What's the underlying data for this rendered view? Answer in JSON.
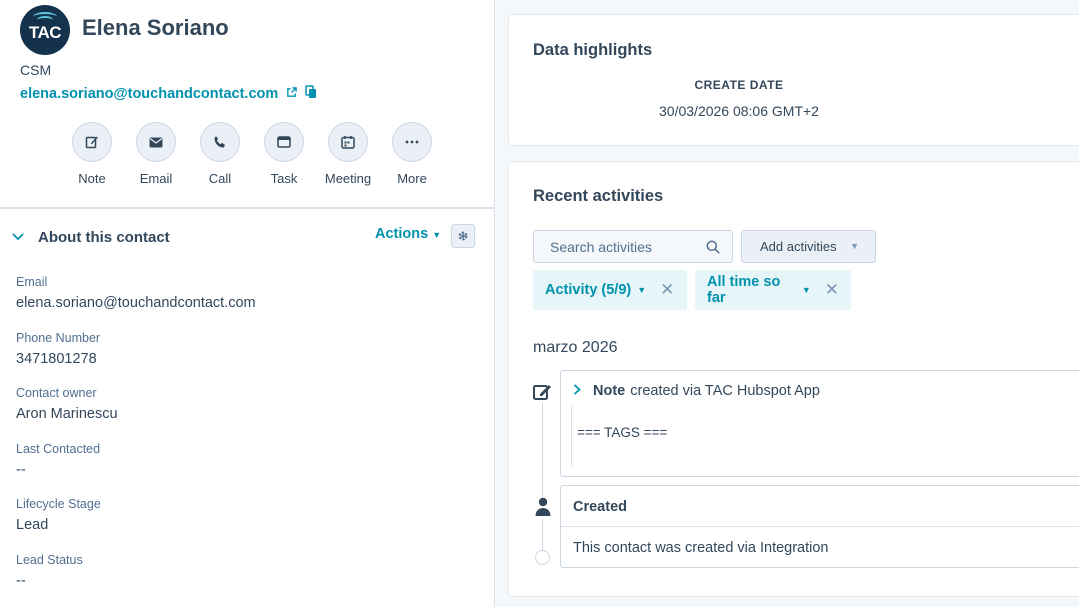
{
  "contact": {
    "avatar_text": "TAC",
    "name": "Elena Soriano",
    "job_title": "CSM",
    "email": "elena.soriano@touchandcontact.com"
  },
  "quick_actions": [
    {
      "label": "Note",
      "icon": "note-edit-icon"
    },
    {
      "label": "Email",
      "icon": "envelope-icon"
    },
    {
      "label": "Call",
      "icon": "phone-icon"
    },
    {
      "label": "Task",
      "icon": "task-icon"
    },
    {
      "label": "Meeting",
      "icon": "calendar-icon"
    },
    {
      "label": "More",
      "icon": "more-dots-icon"
    }
  ],
  "about": {
    "title": "About this contact",
    "actions_label": "Actions",
    "properties": [
      {
        "label": "Email",
        "value": "elena.soriano@touchandcontact.com"
      },
      {
        "label": "Phone Number",
        "value": "3471801278"
      },
      {
        "label": "Contact owner",
        "value": "Aron Marinescu"
      },
      {
        "label": "Last Contacted",
        "value": "--"
      },
      {
        "label": "Lifecycle Stage",
        "value": "Lead"
      },
      {
        "label": "Lead Status",
        "value": "--"
      }
    ]
  },
  "highlights": {
    "title": "Data highlights",
    "create_date_label": "CREATE DATE",
    "create_date_value": "30/03/2026 08:06 GMT+2"
  },
  "activities": {
    "title": "Recent activities",
    "search_placeholder": "Search activities",
    "add_label": "Add activities",
    "filter_activity": "Activity (5/9)",
    "filter_time": "All time so far",
    "month": "marzo 2026",
    "items": [
      {
        "type": "Note",
        "meta": "created via TAC Hubspot App",
        "body": "=== TAGS ==="
      },
      {
        "type": "Created",
        "body": "This contact was created via Integration"
      }
    ]
  },
  "colors": {
    "accent": "#0091ae",
    "text": "#33475b",
    "avatar_bg": "#14324b"
  }
}
